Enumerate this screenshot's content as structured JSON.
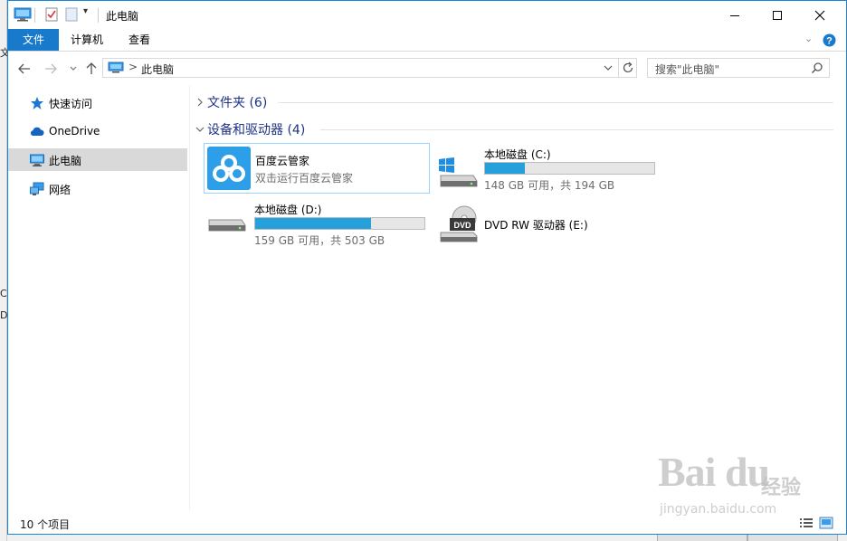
{
  "window": {
    "title": "此电脑"
  },
  "ribbon": {
    "tabs": [
      "文件",
      "计算机",
      "查看"
    ]
  },
  "address": {
    "crumb": "此电脑",
    "separator": ">"
  },
  "search": {
    "placeholder": "搜索\"此电脑\""
  },
  "navpane": {
    "items": [
      {
        "label": "快速访问",
        "icon": "star-icon"
      },
      {
        "label": "OneDrive",
        "icon": "cloud-icon"
      },
      {
        "label": "此电脑",
        "icon": "computer-icon",
        "selected": true
      },
      {
        "label": "网络",
        "icon": "network-icon"
      }
    ]
  },
  "groups": {
    "folders": {
      "label": "文件夹 (6)",
      "expanded": false
    },
    "devices": {
      "label": "设备和驱动器 (4)",
      "expanded": true
    }
  },
  "devices": [
    {
      "name": "百度云管家",
      "sub": "双击运行百度云管家",
      "icon": "baidu-cloud-icon"
    },
    {
      "name": "本地磁盘 (C:)",
      "sub": "148 GB 可用，共 194 GB",
      "used_fraction": 0.237,
      "icon": "windows-drive-icon"
    },
    {
      "name": "本地磁盘 (D:)",
      "sub": "159 GB 可用，共 503 GB",
      "used_fraction": 0.684,
      "icon": "hard-drive-icon"
    },
    {
      "name": "DVD RW 驱动器 (E:)",
      "icon": "dvd-drive-icon"
    }
  ],
  "status": {
    "item_count": "10 个项目"
  },
  "background": {
    "left_fragments": [
      "文",
      "C:",
      "D:"
    ]
  },
  "watermark": {
    "main": "Bai du",
    "cn": "经验",
    "url": "jingyan.baidu.com"
  },
  "colors": {
    "accent": "#1979ca",
    "fill": "#26a0da",
    "header": "#1e3287",
    "selected": "#d9d9d9"
  }
}
